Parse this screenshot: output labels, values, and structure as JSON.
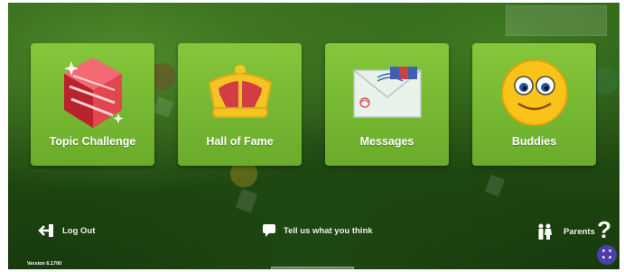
{
  "cards": [
    {
      "label": "Topic Challenge",
      "icon": "ruby-gem-icon"
    },
    {
      "label": "Hall of Fame",
      "icon": "crown-icon"
    },
    {
      "label": "Messages",
      "icon": "envelope-icon"
    },
    {
      "label": "Buddies",
      "icon": "smiley-face-icon"
    }
  ],
  "footer": {
    "logout_label": "Log Out",
    "feedback_label": "Tell us what you think",
    "parents_label": "Parents",
    "help_label": "?",
    "version_label": "Version 6.1700"
  },
  "colors": {
    "card_green": "#7dbb35",
    "background_green": "#255010",
    "fab_purple": "#4e3ea9"
  }
}
